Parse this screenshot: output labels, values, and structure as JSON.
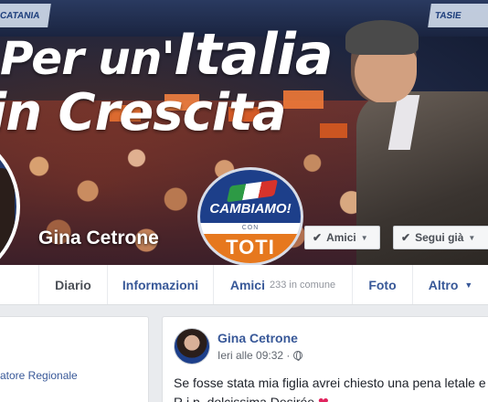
{
  "cover": {
    "headline_line1_a": "Per un'",
    "headline_line1_b": "Italia",
    "headline_line2": "in Crescita",
    "banner_left": "CATANIA",
    "banner_right": "TASIE",
    "logo_top": "CAMBIAMO!",
    "logo_con": "CON",
    "logo_bottom": "TOTI"
  },
  "profile": {
    "name": "Gina Cetrone",
    "friends_button": "Amici",
    "follow_button": "Segui già"
  },
  "tabs": [
    {
      "label": "Diario"
    },
    {
      "label": "Informazioni"
    },
    {
      "label": "Amici",
      "sub": "233 in comune"
    },
    {
      "label": "Foto"
    },
    {
      "label": "Altro"
    }
  ],
  "left_card": {
    "text": "atore Regionale"
  },
  "post": {
    "author": "Gina Cetrone",
    "time": "Ieri alle 09:32 ·",
    "line1": "Se fosse stata mia figlia avrei chiesto una pena letale e",
    "line2": "R.i.p. dolcissima Desirée",
    "heart": "❤"
  },
  "colors": {
    "link_blue": "#385898",
    "logo_blue": "#1d3f8a",
    "logo_orange": "#e6781e",
    "page_bg": "#e9ebee"
  }
}
